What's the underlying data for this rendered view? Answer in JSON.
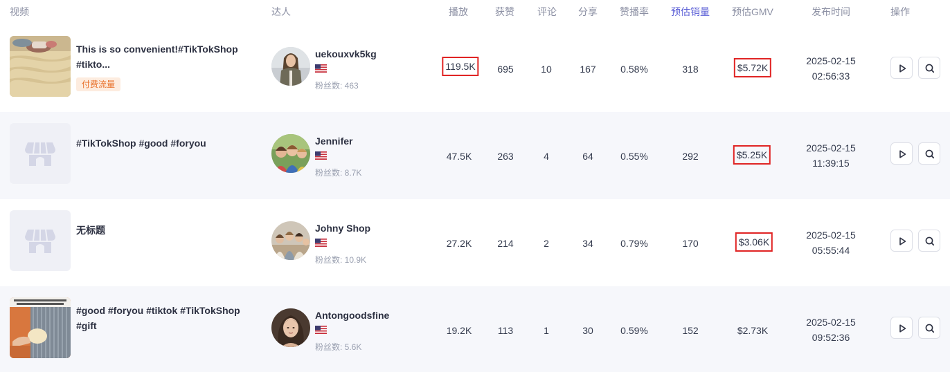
{
  "columns": {
    "video": "视频",
    "creator": "达人",
    "plays": "播放",
    "likes": "获赞",
    "comments": "评论",
    "shares": "分享",
    "like_rate": "赞播率",
    "est_sales": "预估销量",
    "est_gmv": "预估GMV",
    "publish_time": "发布时间",
    "actions": "操作"
  },
  "rows": [
    {
      "title": "This is so convenient!#TikTokShop #tikto...",
      "tag": "付费流量",
      "creator_name": "uekouxvk5kg",
      "fans": "粉丝数: 463",
      "plays": "119.5K",
      "likes": "695",
      "comments": "10",
      "shares": "167",
      "like_rate": "0.58%",
      "sales": "318",
      "gmv": "$5.72K",
      "date": "2025-02-15",
      "time": "02:56:33"
    },
    {
      "title": "#TikTokShop #good #foryou",
      "creator_name": "Jennifer",
      "fans": "粉丝数: 8.7K",
      "plays": "47.5K",
      "likes": "263",
      "comments": "4",
      "shares": "64",
      "like_rate": "0.55%",
      "sales": "292",
      "gmv": "$5.25K",
      "date": "2025-02-15",
      "time": "11:39:15"
    },
    {
      "title": "无标题",
      "creator_name": "Johny Shop",
      "fans": "粉丝数: 10.9K",
      "plays": "27.2K",
      "likes": "214",
      "comments": "2",
      "shares": "34",
      "like_rate": "0.79%",
      "sales": "170",
      "gmv": "$3.06K",
      "date": "2025-02-15",
      "time": "05:55:44"
    },
    {
      "title": "#good #foryou #tiktok #TikTokShop #gift",
      "creator_name": "Antongoodsfine",
      "fans": "粉丝数: 5.6K",
      "plays": "19.2K",
      "likes": "113",
      "comments": "1",
      "shares": "30",
      "like_rate": "0.59%",
      "sales": "152",
      "gmv": "$2.73K",
      "date": "2025-02-15",
      "time": "09:52:36"
    }
  ],
  "icons": {
    "play": "play-icon",
    "search": "search-icon",
    "flag": "us-flag-icon",
    "placeholder": "video-placeholder-icon"
  },
  "colors": {
    "active_header": "#5b5fd6",
    "highlight_box": "#e02424",
    "paid_tag_text": "#e8702a",
    "paid_tag_bg": "#fdecdf",
    "alt_row_bg": "#f6f7fb"
  }
}
